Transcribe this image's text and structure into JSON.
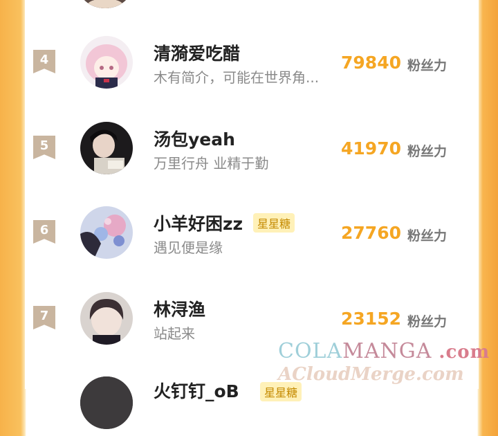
{
  "fans_label": "粉丝力",
  "colors": {
    "count": "#f5a623",
    "rank_badge": "#c9b59f",
    "frame_orange": "#f7b24a"
  },
  "rows": [
    {
      "rank": "4",
      "name": "清漪爱吃醋",
      "tag": "",
      "bio": "木有简介，可能在世界角...",
      "count": "79840"
    },
    {
      "rank": "5",
      "name": "汤包yeah",
      "tag": "",
      "bio": "万里行舟 业精于勤",
      "count": "41970"
    },
    {
      "rank": "6",
      "name": "小羊好困zz",
      "tag": "星星糖",
      "bio": "遇见便是缘",
      "count": "27760"
    },
    {
      "rank": "7",
      "name": "林浔渔",
      "tag": "",
      "bio": "站起来",
      "count": "23152"
    },
    {
      "name_partial": "火钉钉_oB",
      "tag": "星星糖"
    }
  ],
  "watermark": {
    "line1_a": "COLA",
    "line1_b": "MANGA",
    "line1_c": ".com",
    "line2": "ACloudMerge.com"
  }
}
